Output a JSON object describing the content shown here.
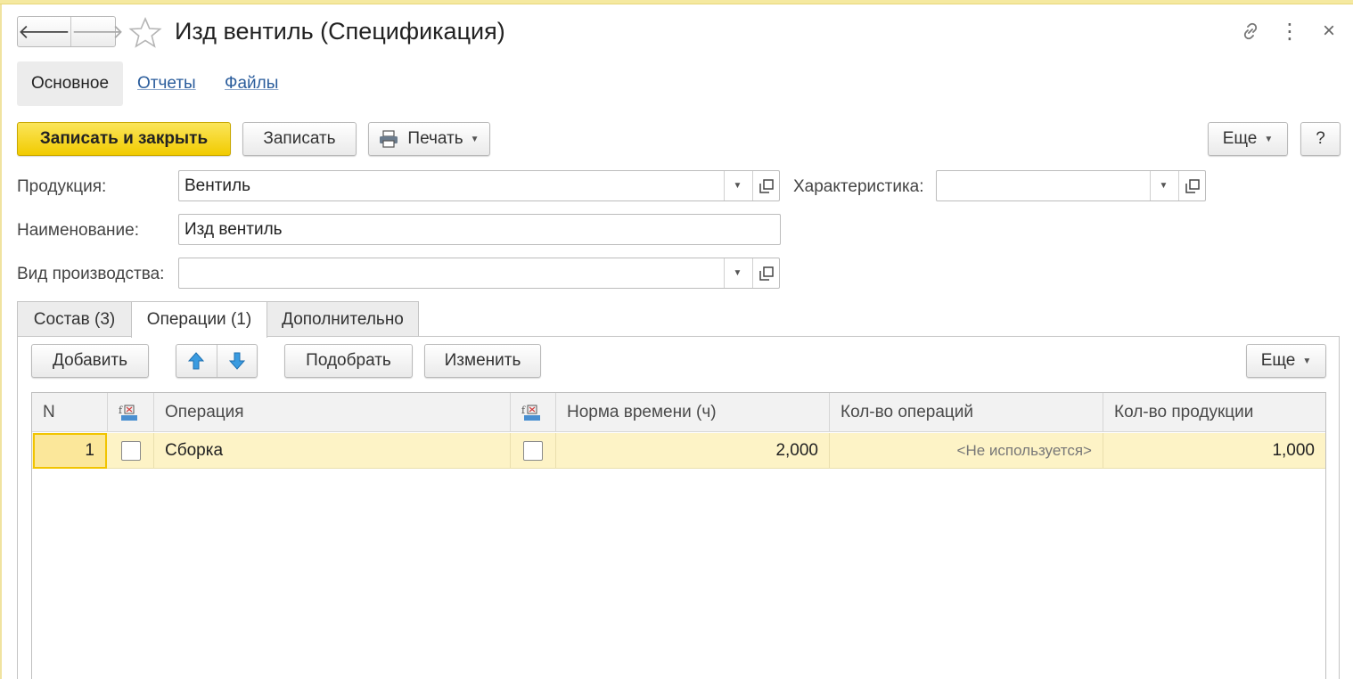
{
  "window": {
    "title": "Изд вентиль (Спецификация)",
    "nav_back": "🡐",
    "nav_forward": "🡒",
    "icons": [
      "star-icon",
      "link-icon",
      "more-icon",
      "close-icon"
    ],
    "more_glyph": "⋮",
    "close_glyph": "×"
  },
  "sections": [
    {
      "label": "Основное",
      "active": true
    },
    {
      "label": "Отчеты",
      "active": false
    },
    {
      "label": "Файлы",
      "active": false
    }
  ],
  "toolbar": {
    "save_close": "Записать и закрыть",
    "save": "Записать",
    "print": "Печать",
    "more": "Еще",
    "help": "?"
  },
  "form": {
    "product_label": "Продукция:",
    "product_value": "Вентиль",
    "characteristic_label": "Характеристика:",
    "characteristic_value": "",
    "name_label": "Наименование:",
    "name_value": "Изд вентиль",
    "production_type_label": "Вид производства:",
    "production_type_value": ""
  },
  "tabs": [
    {
      "label": "Состав (3)",
      "active": false
    },
    {
      "label": "Операции (1)",
      "active": true
    },
    {
      "label": "Дополнительно",
      "active": false
    }
  ],
  "table_toolbar": {
    "add": "Добавить",
    "up_icon": "arrow-up-icon",
    "down_icon": "arrow-down-icon",
    "pick": "Подобрать",
    "edit": "Изменить",
    "more": "Еще"
  },
  "table": {
    "columns": [
      "N",
      "",
      "Операция",
      "",
      "Норма времени (ч)",
      "Кол-во операций",
      "Кол-во продукции"
    ],
    "rows": [
      {
        "n": "1",
        "flag1": false,
        "operation": "Сборка",
        "flag2": false,
        "time_norm": "2,000",
        "op_count": "<Не используется>",
        "product_count": "1,000"
      }
    ]
  },
  "colors": {
    "primary_button": "#f1cb00",
    "selected_row": "#fdf3c6",
    "link": "#2b5d9c"
  }
}
